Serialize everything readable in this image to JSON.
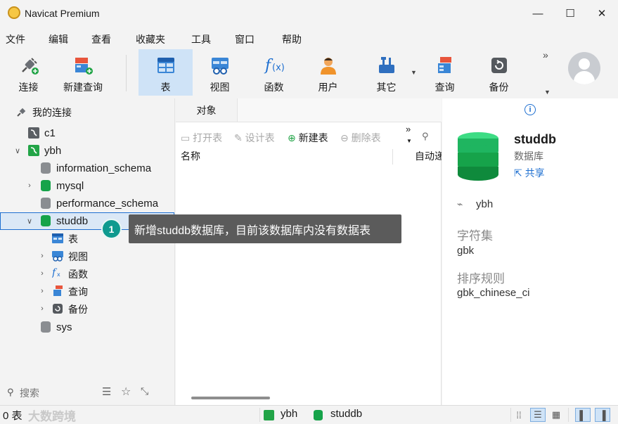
{
  "window": {
    "title": "Navicat Premium",
    "controls": {
      "minimize": "—",
      "maximize": "☐",
      "close": "✕"
    }
  },
  "menu": [
    "文件",
    "编辑",
    "查看",
    "收藏夹",
    "工具",
    "窗口",
    "帮助"
  ],
  "toolbar": {
    "items": [
      {
        "label": "连接",
        "icon": "plug-icon"
      },
      {
        "label": "新建查询",
        "icon": "new-query-icon"
      },
      {
        "label": "表",
        "icon": "table-icon",
        "active": true
      },
      {
        "label": "视图",
        "icon": "view-icon"
      },
      {
        "label": "函数",
        "icon": "function-icon"
      },
      {
        "label": "用户",
        "icon": "user-icon"
      },
      {
        "label": "其它",
        "icon": "tools-icon"
      },
      {
        "label": "查询",
        "icon": "query-icon"
      },
      {
        "label": "备份",
        "icon": "backup-icon"
      }
    ],
    "more": "»"
  },
  "connections": {
    "header": "我的连接",
    "tree": [
      {
        "label": "c1",
        "level": 1,
        "icon": "connection-icon"
      },
      {
        "label": "ybh",
        "level": 1,
        "icon": "connection-active-icon",
        "expanded": true
      },
      {
        "label": "information_schema",
        "level": 2,
        "icon": "database-icon"
      },
      {
        "label": "mysql",
        "level": 2,
        "icon": "database-open-icon"
      },
      {
        "label": "performance_schema",
        "level": 2,
        "icon": "database-icon"
      },
      {
        "label": "studdb",
        "level": 2,
        "icon": "database-open-icon",
        "selected": true,
        "expanded": true
      },
      {
        "label": "表",
        "level": 3,
        "icon": "table-icon"
      },
      {
        "label": "视图",
        "level": 3,
        "icon": "view-icon"
      },
      {
        "label": "函数",
        "level": 3,
        "icon": "function-icon"
      },
      {
        "label": "查询",
        "level": 3,
        "icon": "query-icon"
      },
      {
        "label": "备份",
        "level": 3,
        "icon": "backup-icon"
      },
      {
        "label": "sys",
        "level": 2,
        "icon": "database-icon"
      }
    ],
    "search_placeholder": "搜索"
  },
  "objects": {
    "tab": "对象",
    "tools": [
      "打开表",
      "设计表",
      "新建表",
      "删除表"
    ],
    "more": "»",
    "columns": [
      "名称",
      "自动递"
    ]
  },
  "callout": {
    "number": "1",
    "text": "新增studdb数据库，目前该数据库内没有数据表"
  },
  "info": {
    "name": "studdb",
    "type": "数据库",
    "share": "共享",
    "connection": "ybh",
    "charset_label": "字符集",
    "charset": "gbk",
    "collation_label": "排序规则",
    "collation": "gbk_chinese_ci"
  },
  "status": {
    "count": "0 表",
    "watermark": "大数跨境",
    "connection": "ybh",
    "database": "studdb"
  },
  "colors": {
    "accent": "#1e6fd0",
    "active_bg": "#cfe3f7",
    "db_green": "#16a34a",
    "callout_bg": "#5b5b5b",
    "badge": "#0f9a8f"
  }
}
